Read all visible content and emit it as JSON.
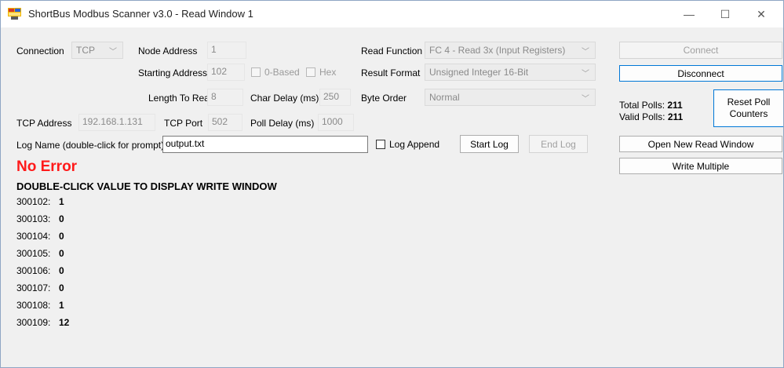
{
  "window": {
    "title": "ShortBus Modbus Scanner v3.0 - Read Window 1",
    "controls": {
      "minimize": "—",
      "maximize": "☐",
      "close": "✕"
    }
  },
  "connection": {
    "label": "Connection",
    "value": "TCP"
  },
  "node_address": {
    "label": "Node Address",
    "value": "1"
  },
  "starting_address": {
    "label": "Starting Address",
    "value": "102",
    "zero_based_label": "0-Based",
    "hex_label": "Hex"
  },
  "length_to_read": {
    "label": "Length To Read",
    "value": "8"
  },
  "char_delay": {
    "label": "Char Delay (ms)",
    "value": "250"
  },
  "tcp_address": {
    "label": "TCP Address",
    "value": "192.168.1.131"
  },
  "tcp_port": {
    "label": "TCP Port",
    "value": "502"
  },
  "poll_delay": {
    "label": "Poll Delay (ms)",
    "value": "1000"
  },
  "read_function": {
    "label": "Read Function",
    "value": "FC 4 - Read 3x (Input Registers)"
  },
  "result_format": {
    "label": "Result Format",
    "value": "Unsigned Integer 16-Bit"
  },
  "byte_order": {
    "label": "Byte Order",
    "value": "Normal"
  },
  "log": {
    "name_label": "Log Name (double-click for prompt)",
    "name_value": "output.txt",
    "append_label": "Log Append",
    "start_label": "Start Log",
    "end_label": "End Log"
  },
  "buttons": {
    "connect": "Connect",
    "disconnect": "Disconnect",
    "reset_poll": "Reset Poll Counters",
    "open_new_read": "Open New Read Window",
    "write_multiple": "Write Multiple"
  },
  "stats": {
    "total_label": "Total Polls:",
    "total_value": "211",
    "valid_label": "Valid Polls:",
    "valid_value": "211"
  },
  "status": {
    "error_text": "No Error",
    "error_color": "#ff1a1a",
    "hint": "DOUBLE-CLICK VALUE TO DISPLAY WRITE WINDOW"
  },
  "registers": [
    {
      "address": "300102:",
      "value": "1"
    },
    {
      "address": "300103:",
      "value": "0"
    },
    {
      "address": "300104:",
      "value": "0"
    },
    {
      "address": "300105:",
      "value": "0"
    },
    {
      "address": "300106:",
      "value": "0"
    },
    {
      "address": "300107:",
      "value": "0"
    },
    {
      "address": "300108:",
      "value": "1"
    },
    {
      "address": "300109:",
      "value": "12"
    }
  ]
}
